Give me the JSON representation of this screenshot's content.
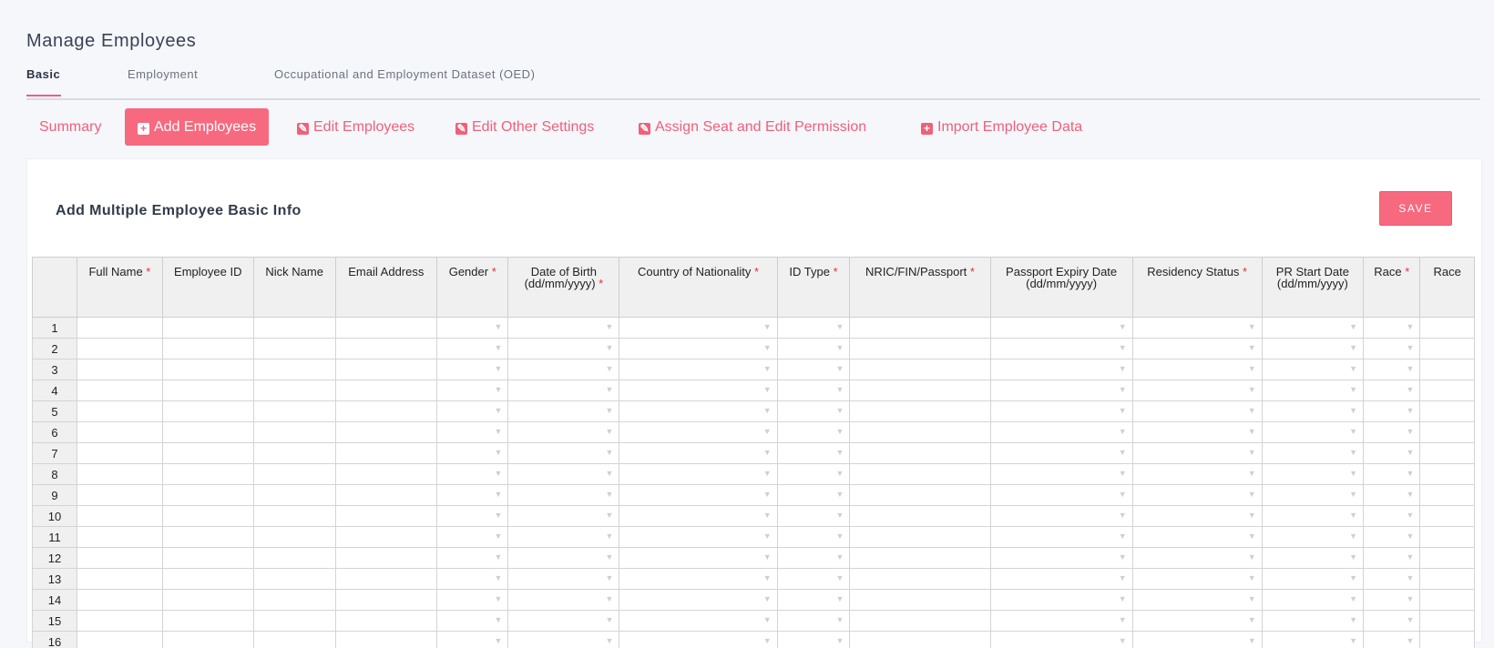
{
  "page": {
    "title": "Manage Employees"
  },
  "top_tabs": [
    {
      "label": "Basic",
      "active": true
    },
    {
      "label": "Employment",
      "active": false
    },
    {
      "label": "Occupational and Employment Dataset (OED)",
      "active": false
    }
  ],
  "sub_tabs": [
    {
      "label": "Summary",
      "icon": "",
      "active": false
    },
    {
      "label": "Add Employees",
      "icon": "plus-square-icon",
      "active": true
    },
    {
      "label": "Edit Employees",
      "icon": "edit-icon",
      "active": false
    },
    {
      "label": "Edit Other Settings",
      "icon": "edit-icon",
      "active": false
    },
    {
      "label": "Assign Seat and Edit Permission",
      "icon": "edit-icon",
      "active": false
    },
    {
      "label": "Import Employee Data",
      "icon": "plus-square-icon",
      "active": false
    }
  ],
  "card": {
    "title": "Add Multiple Employee Basic Info",
    "save_label": "SAVE"
  },
  "grid": {
    "columns": [
      {
        "line1": "Full Name",
        "line2": "",
        "required": true,
        "dropdown": false
      },
      {
        "line1": "Employee ID",
        "line2": "",
        "required": false,
        "dropdown": false
      },
      {
        "line1": "Nick Name",
        "line2": "",
        "required": false,
        "dropdown": false
      },
      {
        "line1": "Email Address",
        "line2": "",
        "required": false,
        "dropdown": false
      },
      {
        "line1": "Gender",
        "line2": "",
        "required": true,
        "dropdown": true
      },
      {
        "line1": "Date of Birth",
        "line2": "(dd/mm/yyyy)",
        "required": true,
        "dropdown": true
      },
      {
        "line1": "Country of Nationality",
        "line2": "",
        "required": true,
        "dropdown": true
      },
      {
        "line1": "ID Type",
        "line2": "",
        "required": true,
        "dropdown": true
      },
      {
        "line1": "NRIC/FIN/Passport",
        "line2": "",
        "required": true,
        "dropdown": false
      },
      {
        "line1": "Passport Expiry Date",
        "line2": "(dd/mm/yyyy)",
        "required": false,
        "dropdown": true
      },
      {
        "line1": "Residency Status",
        "line2": "",
        "required": true,
        "dropdown": true
      },
      {
        "line1": "PR Start Date",
        "line2": "(dd/mm/yyyy)",
        "required": false,
        "dropdown": true
      },
      {
        "line1": "Race",
        "line2": "",
        "required": true,
        "dropdown": true
      },
      {
        "line1": "Race",
        "line2": "",
        "required": false,
        "dropdown": false
      }
    ],
    "rows": [
      "1",
      "2",
      "3",
      "4",
      "5",
      "6",
      "7",
      "8",
      "9",
      "10",
      "11",
      "12",
      "13",
      "14",
      "15",
      "16"
    ]
  },
  "colors": {
    "accent": "#f7697f",
    "required": "#e0323b"
  }
}
